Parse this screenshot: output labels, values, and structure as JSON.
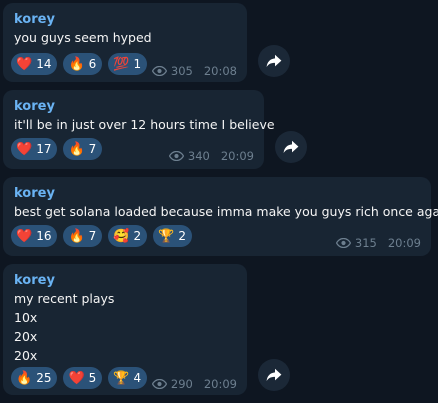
{
  "messages": [
    {
      "author": "korey",
      "lines": [
        "you guys seem hyped"
      ],
      "reactions": [
        {
          "emoji": "❤️",
          "icon": "heart-icon",
          "count": "14"
        },
        {
          "emoji": "🔥",
          "icon": "fire-icon",
          "count": "6"
        },
        {
          "emoji": "💯",
          "icon": "hundred-points-icon",
          "count": "1"
        }
      ],
      "views": "305",
      "time": "20:08",
      "has_share": true
    },
    {
      "author": "korey",
      "lines": [
        "it'll be in just over 12 hours time I believe"
      ],
      "reactions": [
        {
          "emoji": "❤️",
          "icon": "heart-icon",
          "count": "17"
        },
        {
          "emoji": "🔥",
          "icon": "fire-icon",
          "count": "7"
        }
      ],
      "views": "340",
      "time": "20:09",
      "has_share": true
    },
    {
      "author": "korey",
      "lines": [
        "best get solana loaded because imma make you guys rich once again"
      ],
      "reactions": [
        {
          "emoji": "❤️",
          "icon": "heart-icon",
          "count": "16"
        },
        {
          "emoji": "🔥",
          "icon": "fire-icon",
          "count": "7"
        },
        {
          "emoji": "🥰",
          "icon": "smiling-face-with-hearts-icon",
          "count": "2"
        },
        {
          "emoji": "🏆",
          "icon": "trophy-icon",
          "count": "2"
        }
      ],
      "views": "315",
      "time": "20:09",
      "has_share": false
    },
    {
      "author": "korey",
      "lines": [
        "my recent plays",
        "10x",
        "20x",
        "20x"
      ],
      "reactions": [
        {
          "emoji": "🔥",
          "icon": "fire-icon",
          "count": "25"
        },
        {
          "emoji": "❤️",
          "icon": "heart-icon",
          "count": "5"
        },
        {
          "emoji": "🏆",
          "icon": "trophy-icon",
          "count": "4"
        }
      ],
      "views": "290",
      "time": "20:09",
      "has_share": true
    }
  ],
  "colors": {
    "background": "#0e1621",
    "bubble": "#182533",
    "author": "#6ab3f3",
    "reaction_pill": "#2b5278",
    "meta": "#6d7f8f"
  }
}
